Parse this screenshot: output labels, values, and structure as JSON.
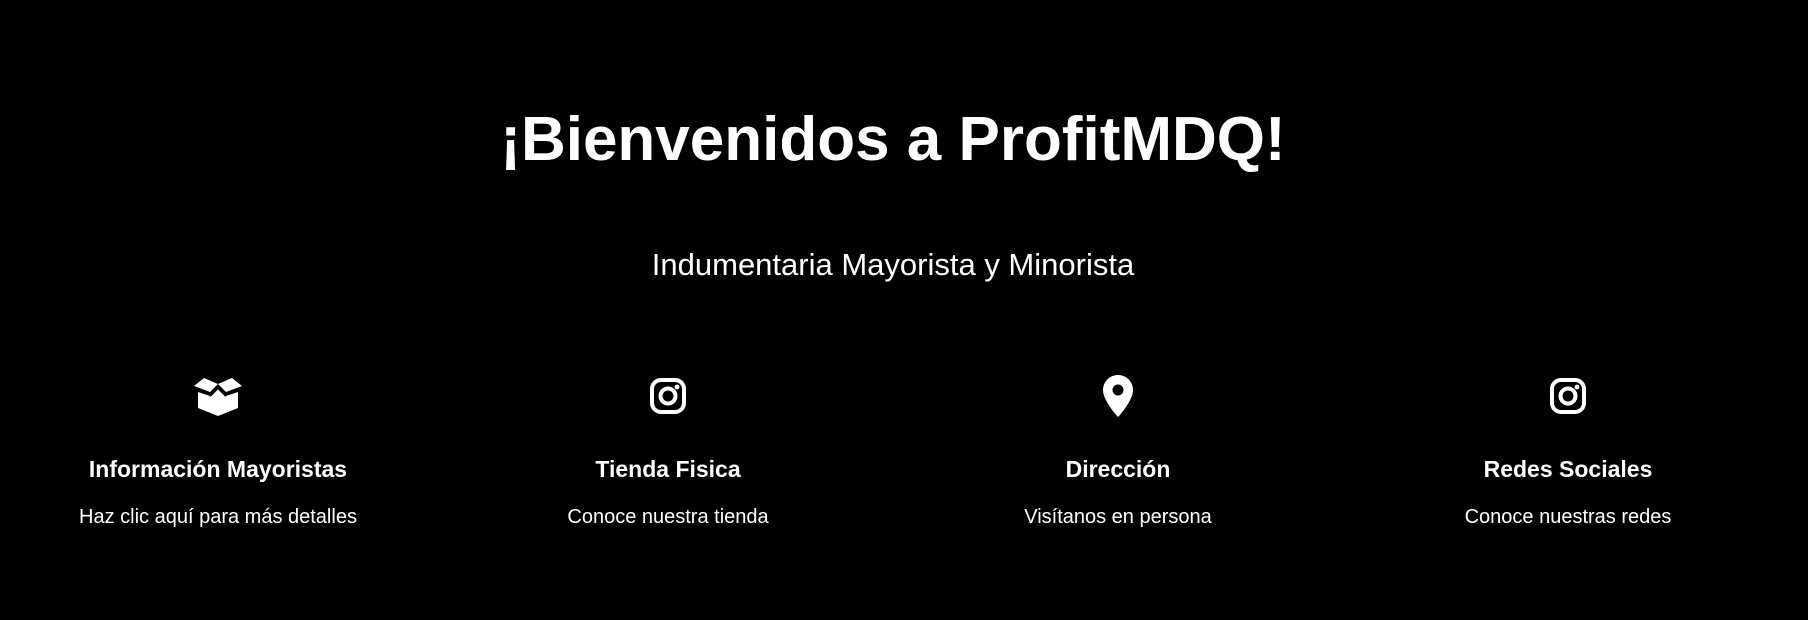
{
  "hero": {
    "title": "¡Bienvenidos a ProfitMDQ!",
    "subtitle": "Indumentaria Mayorista y Minorista"
  },
  "features": [
    {
      "icon": "box-open-icon",
      "title": "Información Mayoristas",
      "description": "Haz clic aquí para más detalles"
    },
    {
      "icon": "instagram-icon",
      "title": "Tienda Fisica",
      "description": "Conoce nuestra tienda"
    },
    {
      "icon": "map-pin-icon",
      "title": "Dirección",
      "description": "Visítanos en persona"
    },
    {
      "icon": "instagram-icon",
      "title": "Redes Sociales",
      "description": "Conoce nuestras redes"
    }
  ],
  "colors": {
    "background": "#000000",
    "text": "#ffffff"
  }
}
